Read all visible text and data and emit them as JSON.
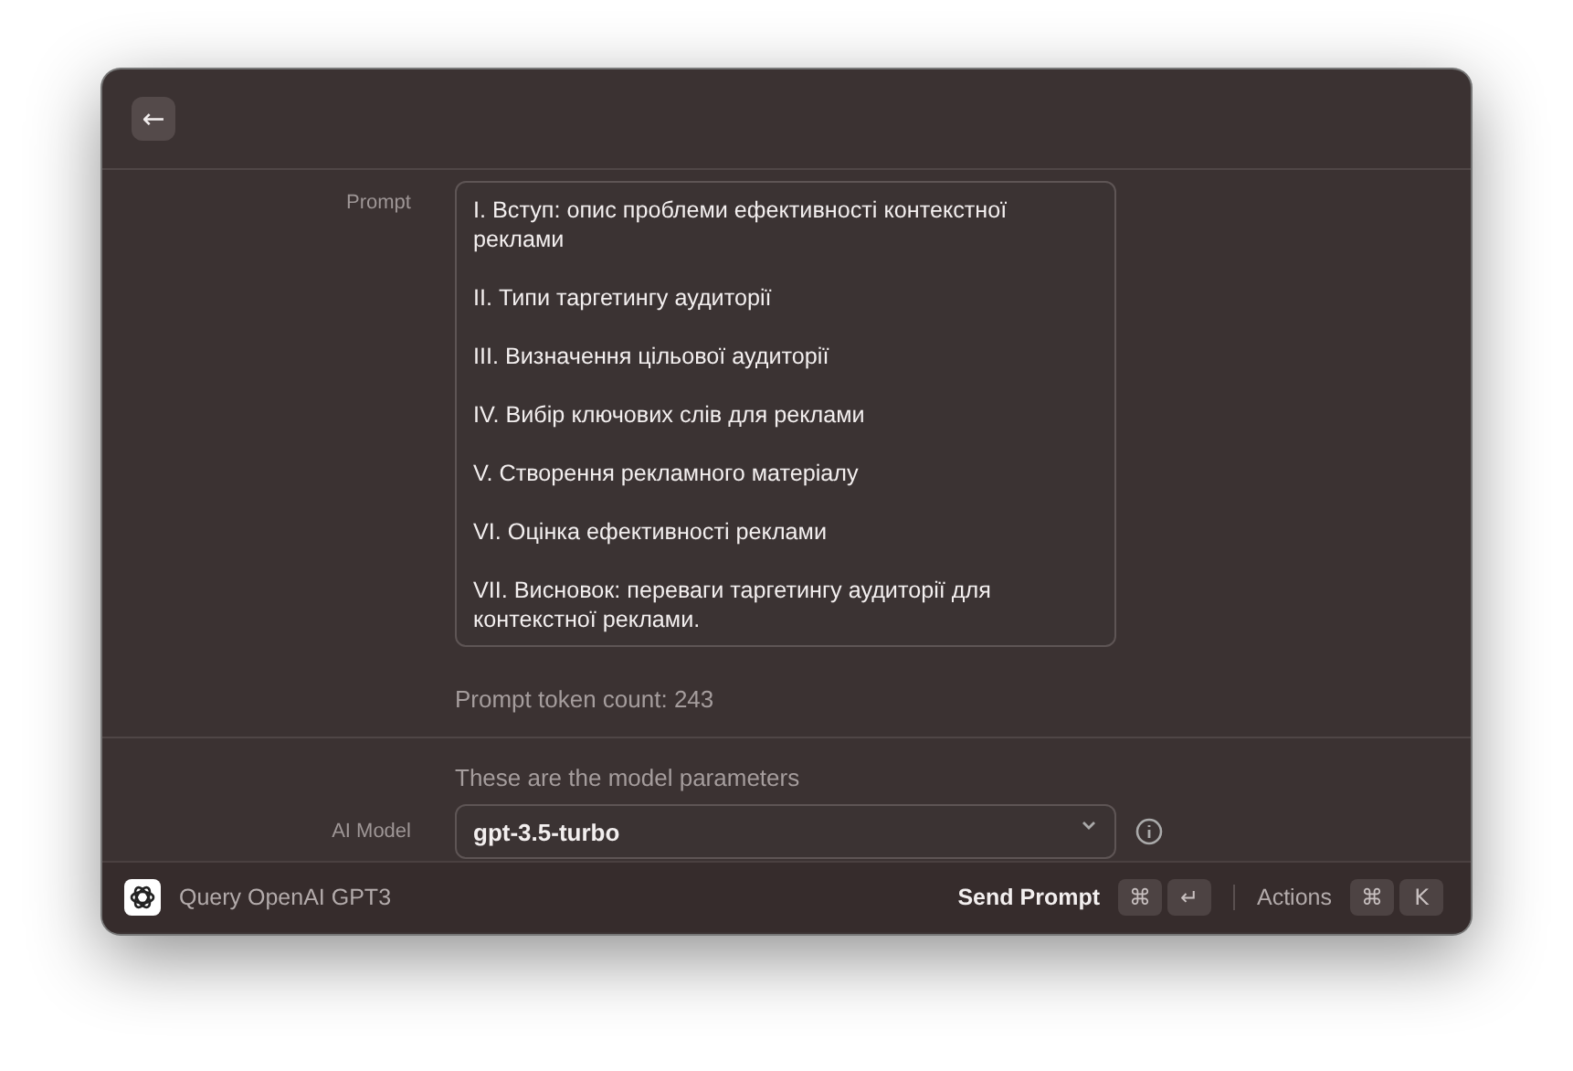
{
  "header": {
    "back_button": "←"
  },
  "form": {
    "prompt_label": "Prompt",
    "prompt_value": "I. Вступ: опис проблеми ефективності контекстної реклами\n\nII. Типи таргетингу аудиторії\n\nIII. Визначення цільової аудиторії\n\nIV. Вибір ключових слів для реклами\n\nV. Створення рекламного матеріалу\n\nVI. Оцінка ефективності реклами\n\nVII. Висновок: переваги таргетингу аудиторії для контекстної реклами.",
    "token_count": "Prompt token count: 243",
    "parameters_note": "These are the model parameters",
    "model_label": "AI Model",
    "model_value": "gpt-3.5-turbo"
  },
  "footer": {
    "title": "Query OpenAI GPT3",
    "primary_action": "Send Prompt",
    "primary_keys": [
      "⌘",
      "↵"
    ],
    "actions_label": "Actions",
    "actions_keys": [
      "⌘",
      "K"
    ]
  }
}
